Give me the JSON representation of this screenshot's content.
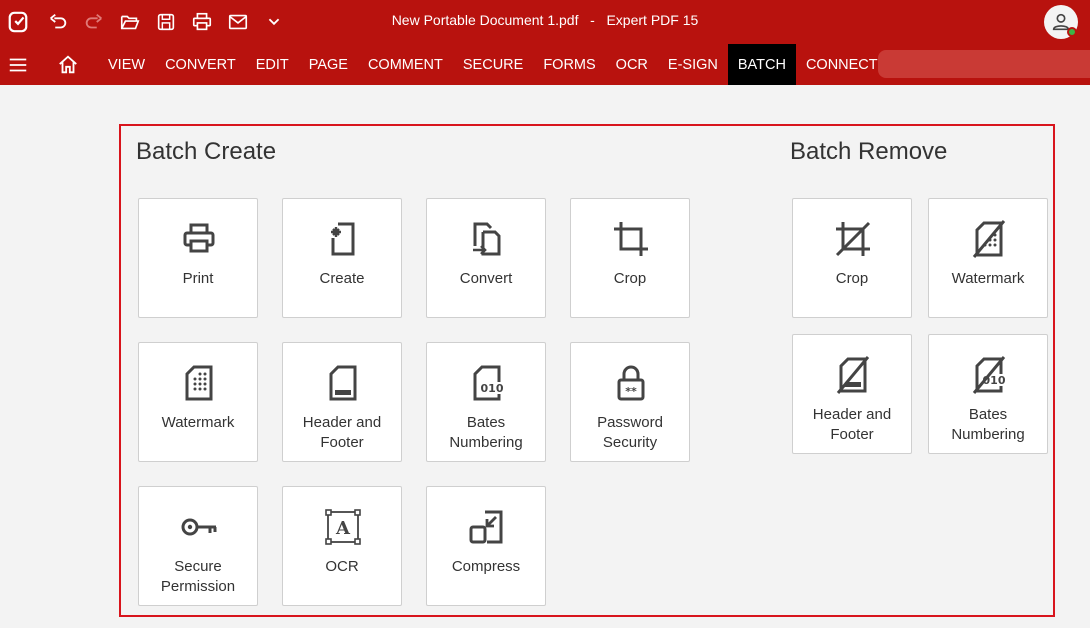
{
  "window": {
    "title": "New Portable Document 1.pdf",
    "separator": "-",
    "app": "Expert PDF 15"
  },
  "quick_access": [
    "app-logo-icon",
    "undo-icon",
    "redo-icon",
    "open-icon",
    "save-icon",
    "print-icon",
    "mail-icon",
    "chevron-down-icon"
  ],
  "menu": {
    "tabs": [
      {
        "label": "VIEW"
      },
      {
        "label": "CONVERT"
      },
      {
        "label": "EDIT"
      },
      {
        "label": "PAGE"
      },
      {
        "label": "COMMENT"
      },
      {
        "label": "SECURE"
      },
      {
        "label": "FORMS"
      },
      {
        "label": "OCR"
      },
      {
        "label": "E-SIGN"
      },
      {
        "label": "BATCH"
      },
      {
        "label": "CONNECT"
      }
    ],
    "active_tab": "BATCH"
  },
  "batch_create": {
    "title": "Batch Create",
    "tiles": [
      {
        "label": "Print",
        "icon": "print-icon"
      },
      {
        "label": "Create",
        "icon": "create-icon"
      },
      {
        "label": "Convert",
        "icon": "convert-icon"
      },
      {
        "label": "Crop",
        "icon": "crop-icon"
      },
      {
        "label": "Watermark",
        "icon": "watermark-icon"
      },
      {
        "label": "Header and Footer",
        "line1": "Header and",
        "line2": "Footer",
        "icon": "header-footer-icon"
      },
      {
        "label": "Bates Numbering",
        "line1": "Bates",
        "line2": "Numbering",
        "icon": "bates-numbering-icon"
      },
      {
        "label": "Password Security",
        "line1": "Password",
        "line2": "Security",
        "icon": "password-lock-icon"
      },
      {
        "label": "Secure Permission",
        "line1": "Secure",
        "line2": "Permission",
        "icon": "key-icon"
      },
      {
        "label": "OCR",
        "icon": "ocr-icon"
      },
      {
        "label": "Compress",
        "icon": "compress-icon"
      }
    ]
  },
  "batch_remove": {
    "title": "Batch Remove",
    "tiles": [
      {
        "label": "Crop",
        "icon": "remove-crop-icon"
      },
      {
        "label": "Watermark",
        "icon": "remove-watermark-icon"
      },
      {
        "label": "Header and Footer",
        "line1": "Header and",
        "line2": "Footer",
        "icon": "remove-header-footer-icon"
      },
      {
        "label": "Bates Numbering",
        "line1": "Bates",
        "line2": "Numbering",
        "icon": "remove-bates-icon"
      }
    ]
  },
  "colors": {
    "brand": "#b8120e",
    "active_tab": "#000000",
    "highlight_border": "#d8141c",
    "status_online": "#3db345"
  }
}
